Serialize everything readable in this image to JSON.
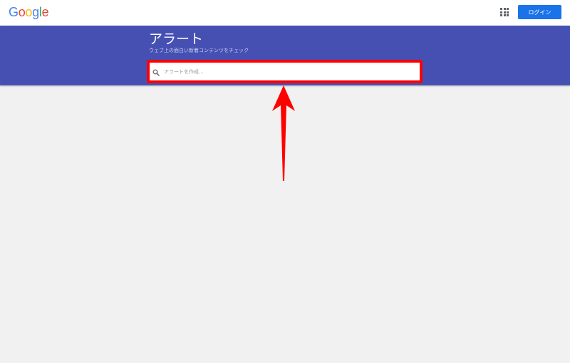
{
  "header": {
    "logo_letters": [
      {
        "char": "G",
        "color": "#4285f4"
      },
      {
        "char": "o",
        "color": "#ea4335"
      },
      {
        "char": "o",
        "color": "#fbbc05"
      },
      {
        "char": "g",
        "color": "#4285f4"
      },
      {
        "char": "l",
        "color": "#34a853"
      },
      {
        "char": "e",
        "color": "#ea4335"
      }
    ],
    "apps_icon": "apps-grid-icon",
    "login_label": "ログイン",
    "login_color": "#1a73e8"
  },
  "hero": {
    "title": "アラート",
    "subtitle": "ウェブ上の面白い新着コンテンツをチェック",
    "background_color": "#4650b3"
  },
  "search": {
    "icon": "search-icon",
    "placeholder": "アラートを作成...",
    "value": ""
  },
  "annotation": {
    "highlight_color": "#ff0000",
    "arrow_icon": "red-up-arrow-icon"
  }
}
